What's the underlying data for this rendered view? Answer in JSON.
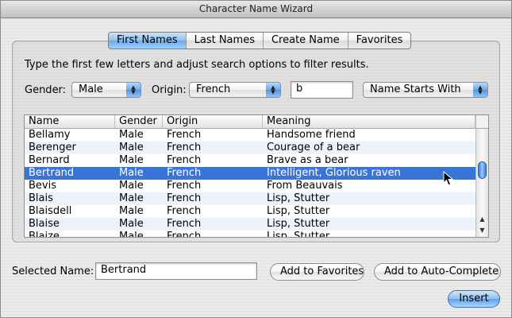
{
  "window": {
    "title": "Character Name Wizard"
  },
  "tabs": [
    {
      "label": "First Names",
      "active": true
    },
    {
      "label": "Last Names",
      "active": false
    },
    {
      "label": "Create Name",
      "active": false
    },
    {
      "label": "Favorites",
      "active": false
    }
  ],
  "instruction": "Type the first few letters and adjust search options to filter results.",
  "filters": {
    "gender_label": "Gender:",
    "gender_value": "Male",
    "origin_label": "Origin:",
    "origin_value": "French",
    "search_value": "b",
    "match_mode_value": "Name Starts With"
  },
  "table": {
    "columns": [
      "Name",
      "Gender",
      "Origin",
      "Meaning"
    ],
    "rows": [
      [
        "Bellamy",
        "Male",
        "French",
        "Handsome friend"
      ],
      [
        "Berenger",
        "Male",
        "French",
        "Courage of a bear"
      ],
      [
        "Bernard",
        "Male",
        "French",
        "Brave as a bear"
      ],
      [
        "Bertrand",
        "Male",
        "French",
        "Intelligent, Glorious raven"
      ],
      [
        "Bevis",
        "Male",
        "French",
        "From Beauvais"
      ],
      [
        "Blais",
        "Male",
        "French",
        "Lisp, Stutter"
      ],
      [
        "Blaisdell",
        "Male",
        "French",
        "Lisp, Stutter"
      ],
      [
        "Blaise",
        "Male",
        "French",
        "Lisp, Stutter"
      ],
      [
        "Blaize",
        "Male",
        "French",
        "Lisp, Stutter"
      ]
    ],
    "selected_index": 3
  },
  "selected_name": {
    "label": "Selected Name:",
    "value": "Bertrand"
  },
  "buttons": {
    "add_favorites": "Add to Favorites",
    "add_autocomplete": "Add to Auto-Complete",
    "insert": "Insert"
  },
  "colors": {
    "selection": "#3875d7",
    "accent": "#6aa9ea",
    "row_alt": "#edf3fe"
  }
}
